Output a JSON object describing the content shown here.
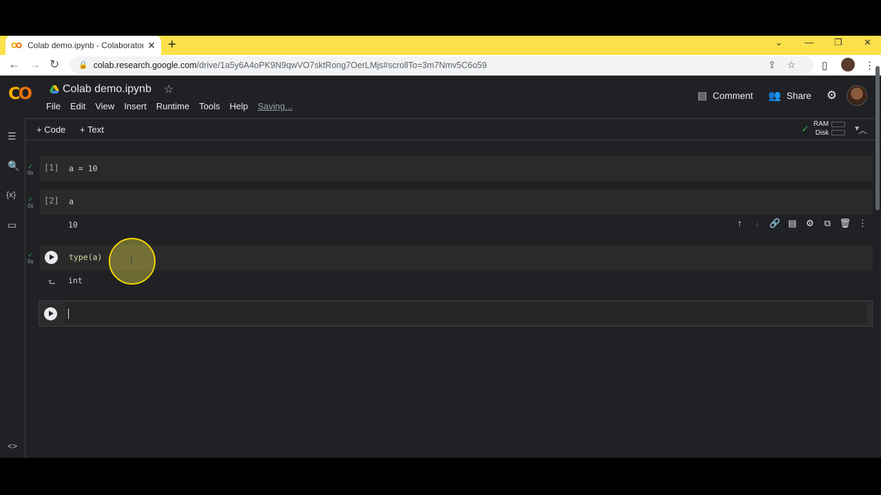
{
  "browser": {
    "tab_title": "Colab demo.ipynb - Colaboratory",
    "tab_close": "✕",
    "new_tab": "+",
    "url_host": "colab.research.google.com",
    "url_path": "/drive/1a5y6A4oPK9N9qwVO7sktRong7OerLMjs#scrollTo=3m7Nmv5C6o59",
    "window_controls": [
      "⌄",
      "—",
      "❐",
      "✕"
    ]
  },
  "colab": {
    "notebook_title": "Colab demo.ipynb",
    "menu": [
      "File",
      "Edit",
      "View",
      "Insert",
      "Runtime",
      "Tools",
      "Help"
    ],
    "saving": "Saving...",
    "comment_label": "Comment",
    "share_label": "Share",
    "add_code": "+ Code",
    "add_text": "+ Text",
    "ram_label": "RAM",
    "disk_label": "Disk",
    "sidebar_icons": [
      "toc-icon",
      "search-icon",
      "variables-icon",
      "files-icon",
      "code-snippets-icon"
    ]
  },
  "cells": [
    {
      "prompt": "[1]",
      "code": "a = 10",
      "exec_time": "0s",
      "output": ""
    },
    {
      "prompt": "[2]",
      "code": "a",
      "exec_time": "0s",
      "output": "10"
    },
    {
      "prompt": "",
      "code": "type(a)",
      "exec_time": "0s",
      "output": "int"
    },
    {
      "prompt": "",
      "code": "",
      "exec_time": "",
      "output": ""
    }
  ],
  "colors": {
    "tabstrip": "#fbe04a",
    "app_bg": "#202124",
    "cell_bg": "#2a2a2a",
    "logo_orange": "#f9ab00",
    "success_green": "#34a853"
  }
}
